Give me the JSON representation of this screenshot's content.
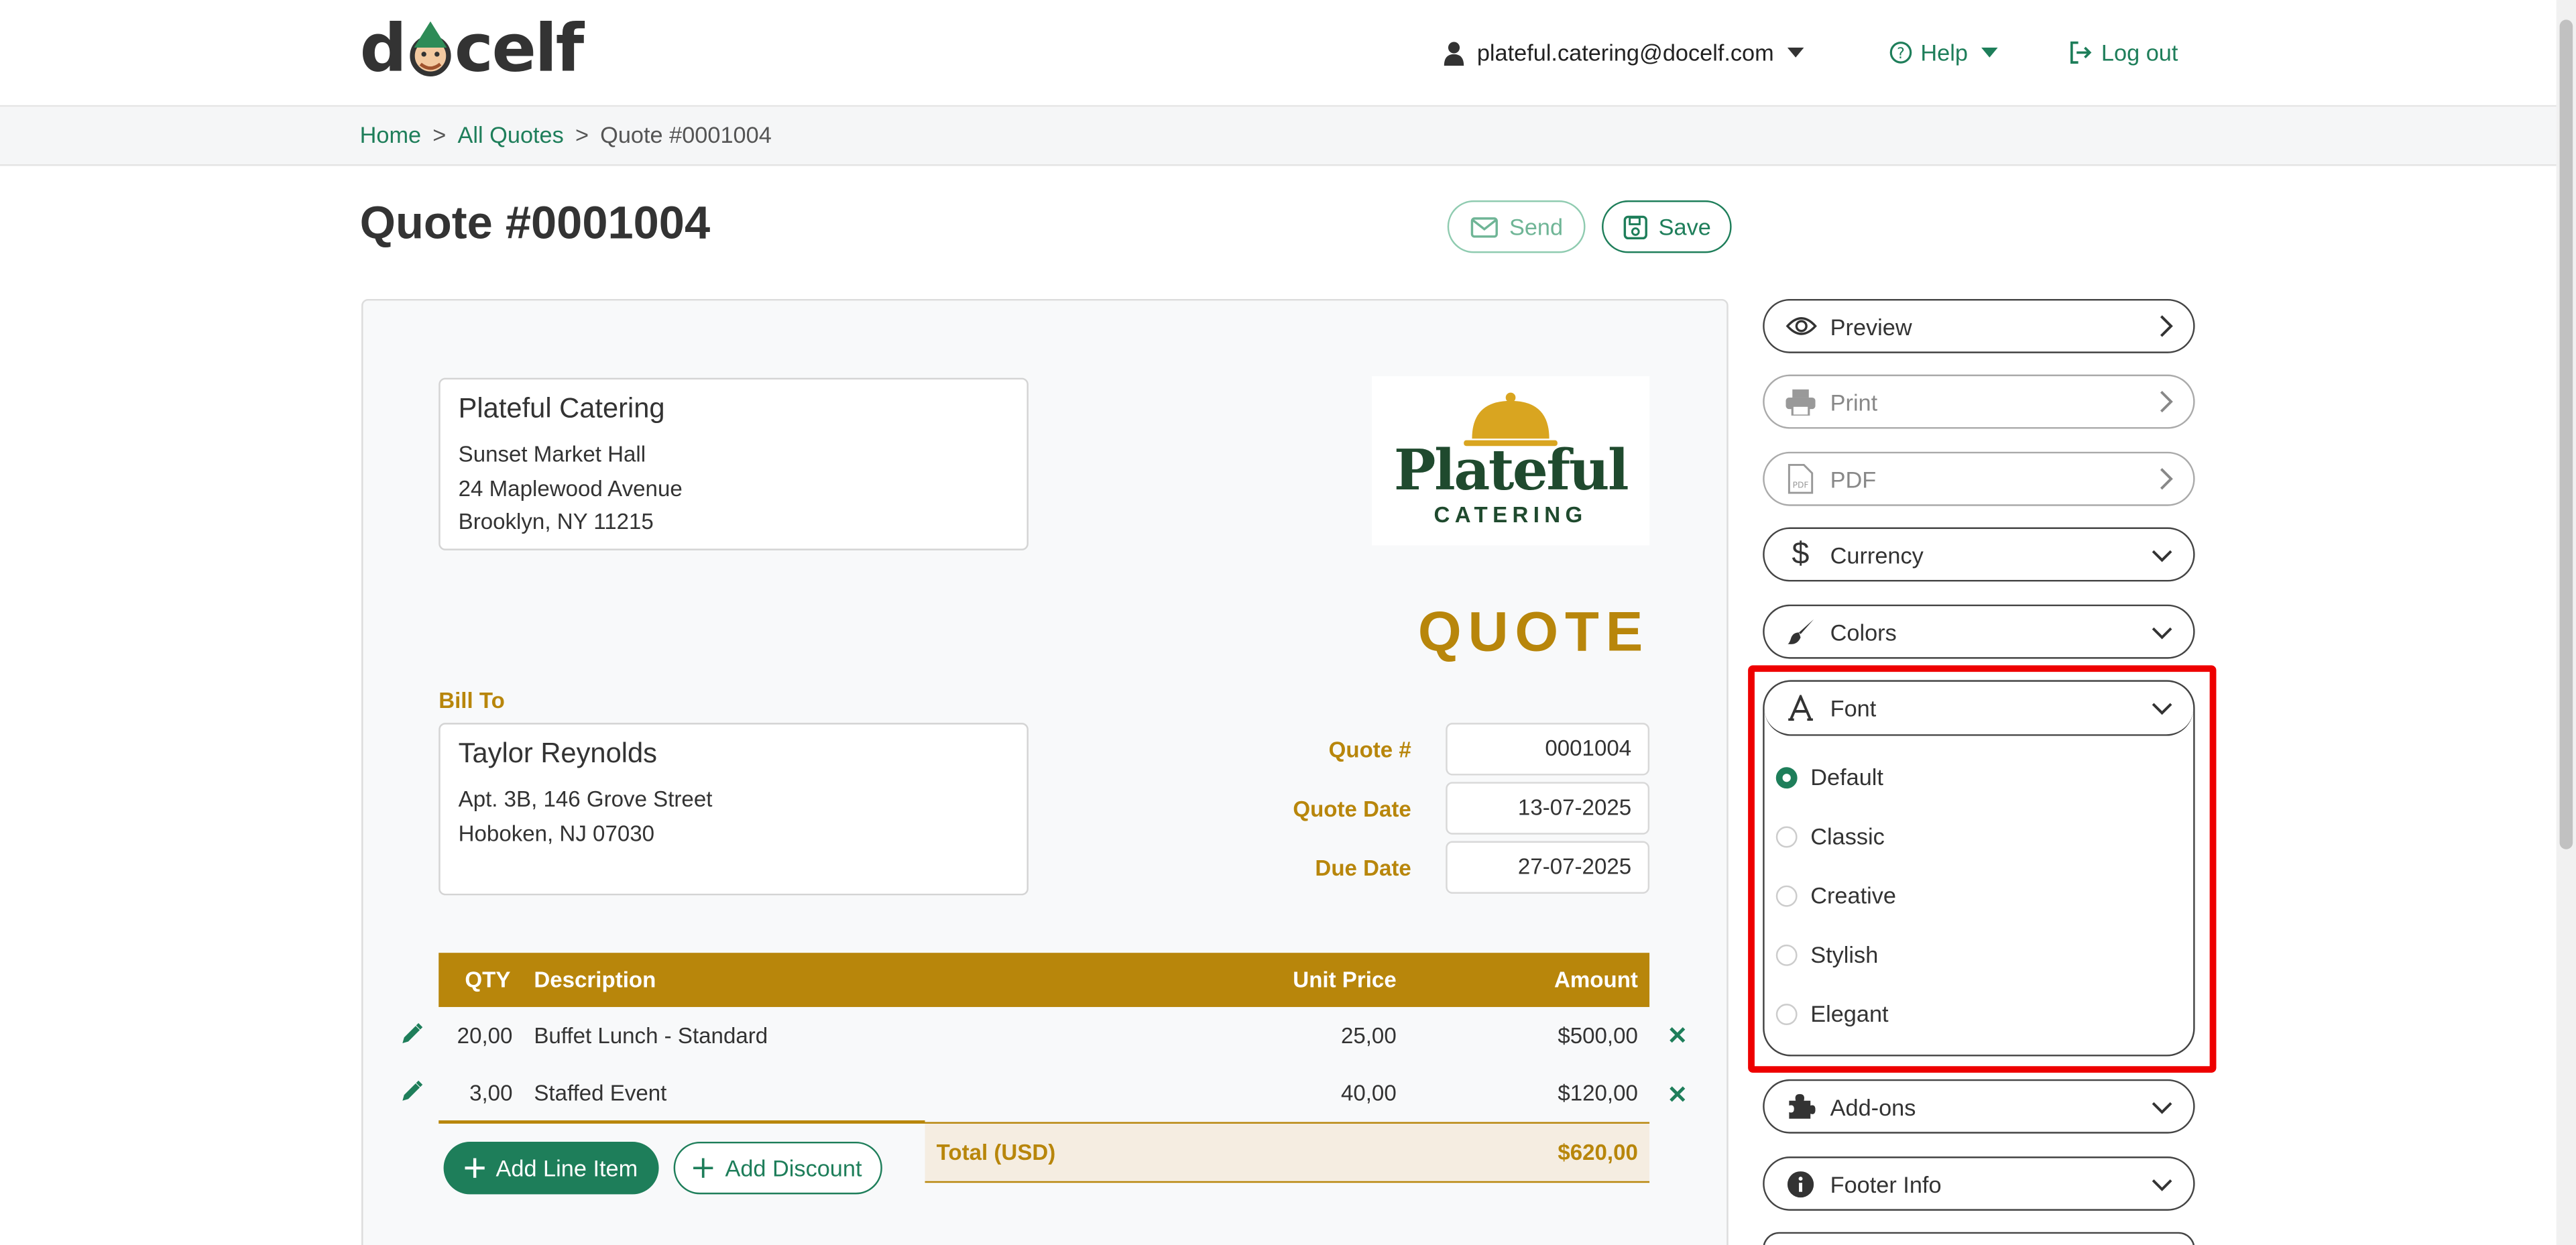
{
  "header": {
    "logo_text": "docelf",
    "user_email": "plateful.catering@docelf.com",
    "help_label": "Help",
    "logout_label": "Log out"
  },
  "breadcrumb": {
    "home": "Home",
    "all_quotes": "All Quotes",
    "current": "Quote #0001004",
    "sep": ">"
  },
  "page": {
    "title": "Quote #0001004",
    "send_label": "Send",
    "save_label": "Save"
  },
  "document": {
    "seller": {
      "name": "Plateful Catering",
      "lines": [
        "Sunset Market Hall",
        "24 Maplewood Avenue",
        "Brooklyn, NY 11215"
      ]
    },
    "logo": {
      "line1": "Plateful",
      "line2": "CATERING"
    },
    "doc_type": "QUOTE",
    "bill_to_label": "Bill To",
    "client": {
      "name": "Taylor Reynolds",
      "lines": [
        "Apt. 3B, 146 Grove Street",
        "Hoboken, NJ 07030"
      ]
    },
    "meta": [
      {
        "label": "Quote #",
        "value": "0001004"
      },
      {
        "label": "Quote Date",
        "value": "13-07-2025"
      },
      {
        "label": "Due Date",
        "value": "27-07-2025"
      }
    ],
    "table": {
      "headers": {
        "qty": "QTY",
        "description": "Description",
        "unit_price": "Unit Price",
        "amount": "Amount"
      },
      "rows": [
        {
          "qty": "20,00",
          "description": "Buffet Lunch - Standard",
          "unit_price": "25,00",
          "amount": "$500,00"
        },
        {
          "qty": "3,00",
          "description": "Staffed Event",
          "unit_price": "40,00",
          "amount": "$120,00"
        }
      ]
    },
    "add_line_label": "Add Line Item",
    "add_discount_label": "Add Discount",
    "total_label": "Total (USD)",
    "total_value": "$620,00"
  },
  "sidebar": {
    "preview": "Preview",
    "print": "Print",
    "pdf": "PDF",
    "currency": "Currency",
    "colors": "Colors",
    "font": "Font",
    "font_options": [
      "Default",
      "Classic",
      "Creative",
      "Stylish",
      "Elegant"
    ],
    "font_selected": "Default",
    "addons": "Add-ons",
    "footer_info": "Footer Info"
  },
  "colors": {
    "accent": "#1e7e5a",
    "gold": "#b8860b",
    "highlight": "#ee0000"
  }
}
